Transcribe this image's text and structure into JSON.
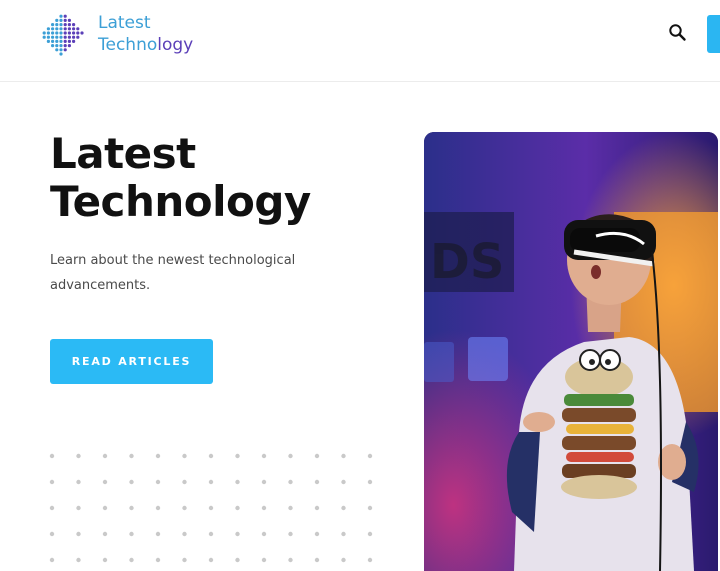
{
  "header": {
    "logo": {
      "line1": "Latest",
      "line2_main": "Techno",
      "line2_accent": "logy"
    },
    "search_icon": "search-icon"
  },
  "hero": {
    "title_line1": "Latest",
    "title_line2": "Technology",
    "description": "Learn about the newest technological advancements.",
    "button_label": "READ ARTICLES",
    "image_alt": "Person wearing a VR headset in a colorful arcade"
  },
  "colors": {
    "accent": "#2bb6f2",
    "logo_blue": "#3c9fd6",
    "logo_purple": "#5b3fb8",
    "heading": "#111111",
    "body_text": "#4a4a4a"
  }
}
